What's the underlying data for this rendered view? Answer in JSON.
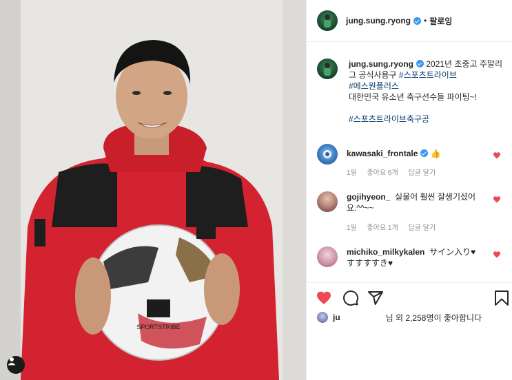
{
  "post_author": {
    "username": "jung.sung.ryong",
    "follow_label": "팔로잉",
    "dot": "•"
  },
  "caption": {
    "username": "jung.sung.ryong",
    "text_1": "2021년 초중고 주말리그 공식사용구 ",
    "hashtag_1": "#스포츠트라이브",
    "hashtag_2": "#에스원플러스",
    "text_2": "대한민국 유소년 축구선수들 파이팅~!",
    "hashtag_3": "#스포츠트라이브축구공"
  },
  "comments": [
    {
      "username": "kawasaki_frontale",
      "text": "",
      "emoji": "👍",
      "time": "1일",
      "likes": "좋아요 6개",
      "reply": "답글 달기"
    },
    {
      "username": "gojihyeon_",
      "text": "실물어 훨씬 잘생기셨어요.^^~~",
      "time": "1일",
      "likes": "좋아요 1개",
      "reply": "답글 달기"
    },
    {
      "username": "michiko_milkykalen",
      "text": "サイン入り♥",
      "text_cont": "すすすすき♥"
    }
  ],
  "likes_bar": {
    "user": "ju",
    "text": "님 외 2,258명이 좋아합니다"
  },
  "colors": {
    "like_red": "#ed4956",
    "link_blue": "#00376b",
    "verified_blue": "#3897f0"
  },
  "icons": [
    "heart-icon",
    "comment-icon",
    "share-icon",
    "bookmark-icon",
    "user-tag-icon",
    "verified-icon"
  ]
}
